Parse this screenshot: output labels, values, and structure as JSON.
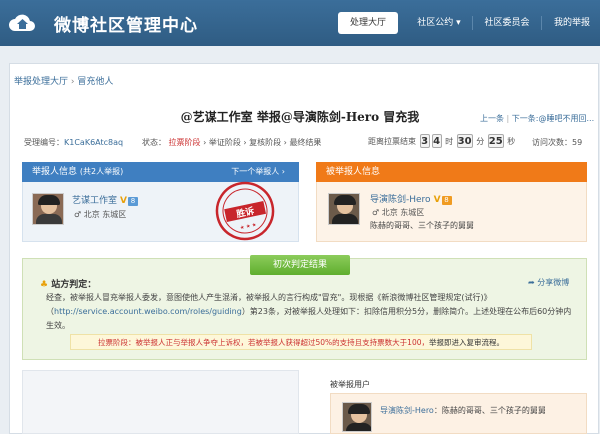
{
  "header": {
    "brand": "微博社区管理中心",
    "nav": [
      {
        "label": "处理大厅"
      },
      {
        "label": "社区公约 ▾"
      },
      {
        "label": "社区委员会"
      },
      {
        "label": "我的举报"
      }
    ]
  },
  "breadcrumb": {
    "parent": "举报处理大厅",
    "current": "冒充他人"
  },
  "case": {
    "title": "@艺谋工作室 举报@导演陈剑-Hero 冒充我",
    "pager": {
      "prev": "上一条",
      "sep": "|",
      "next": "下一条:@睡吧不用回..."
    },
    "id_label": "受理编号：",
    "id_value": "K1CaK6Atc8aq",
    "status_label": "状态：",
    "stages": [
      "拉票阶段",
      "举证阶段",
      "复核阶段",
      "最终结果"
    ],
    "countdown_label": "距离拉票结束",
    "countdown": [
      "3",
      "4",
      "30",
      "25"
    ],
    "countdown_units": [
      "时",
      "分",
      "秒"
    ],
    "visits_label": "访问次数：",
    "visits": "59"
  },
  "reporter": {
    "header": "举报人信息",
    "count": "(共2人举报)",
    "next": "下一个举报人",
    "name": "艺谋工作室",
    "level": "8",
    "location": "北京 东城区",
    "stamp": "胜诉"
  },
  "reported": {
    "header": "被举报人信息",
    "name": "导演陈剑-Hero",
    "level": "8",
    "location": "北京 东城区",
    "description": "陈赫的哥哥、三个孩子的舅舅"
  },
  "judgement": {
    "button": "初次判定结果",
    "stance": "站方判定：",
    "share": "分享微博",
    "text_a": "经查，被举报人冒充举报人委发，意图使他人产生混淆，被举报人的言行构成\"冒充\"。现根据《新浪微博社区管理规定(试行)》（",
    "link_a": "http://service.account.weibo.com/roles/guiding",
    "text_b": "）第23条，对被举报人处理如下：扣除信用积分5分，删除简介。上述处理在公布后60分钟内生效。",
    "notice_a": "拉票阶段：被举报人正与举报人争夺上诉权，若被举报人获得超过50%的支持且支持票数大于100，",
    "notice_b": "举报即进入复审流程。"
  },
  "lower": {
    "reported_user_label": "被举报用户",
    "name": "导演陈剑-Hero",
    "description": "陈赫的哥哥、三个孩子的舅舅"
  },
  "colors": {
    "header_blue": "#2f5c83",
    "reporter_blue": "#3f7fc1",
    "reported_orange": "#f07a18",
    "judge_green": "#6cb83a",
    "stamp_red": "#c8262c"
  }
}
